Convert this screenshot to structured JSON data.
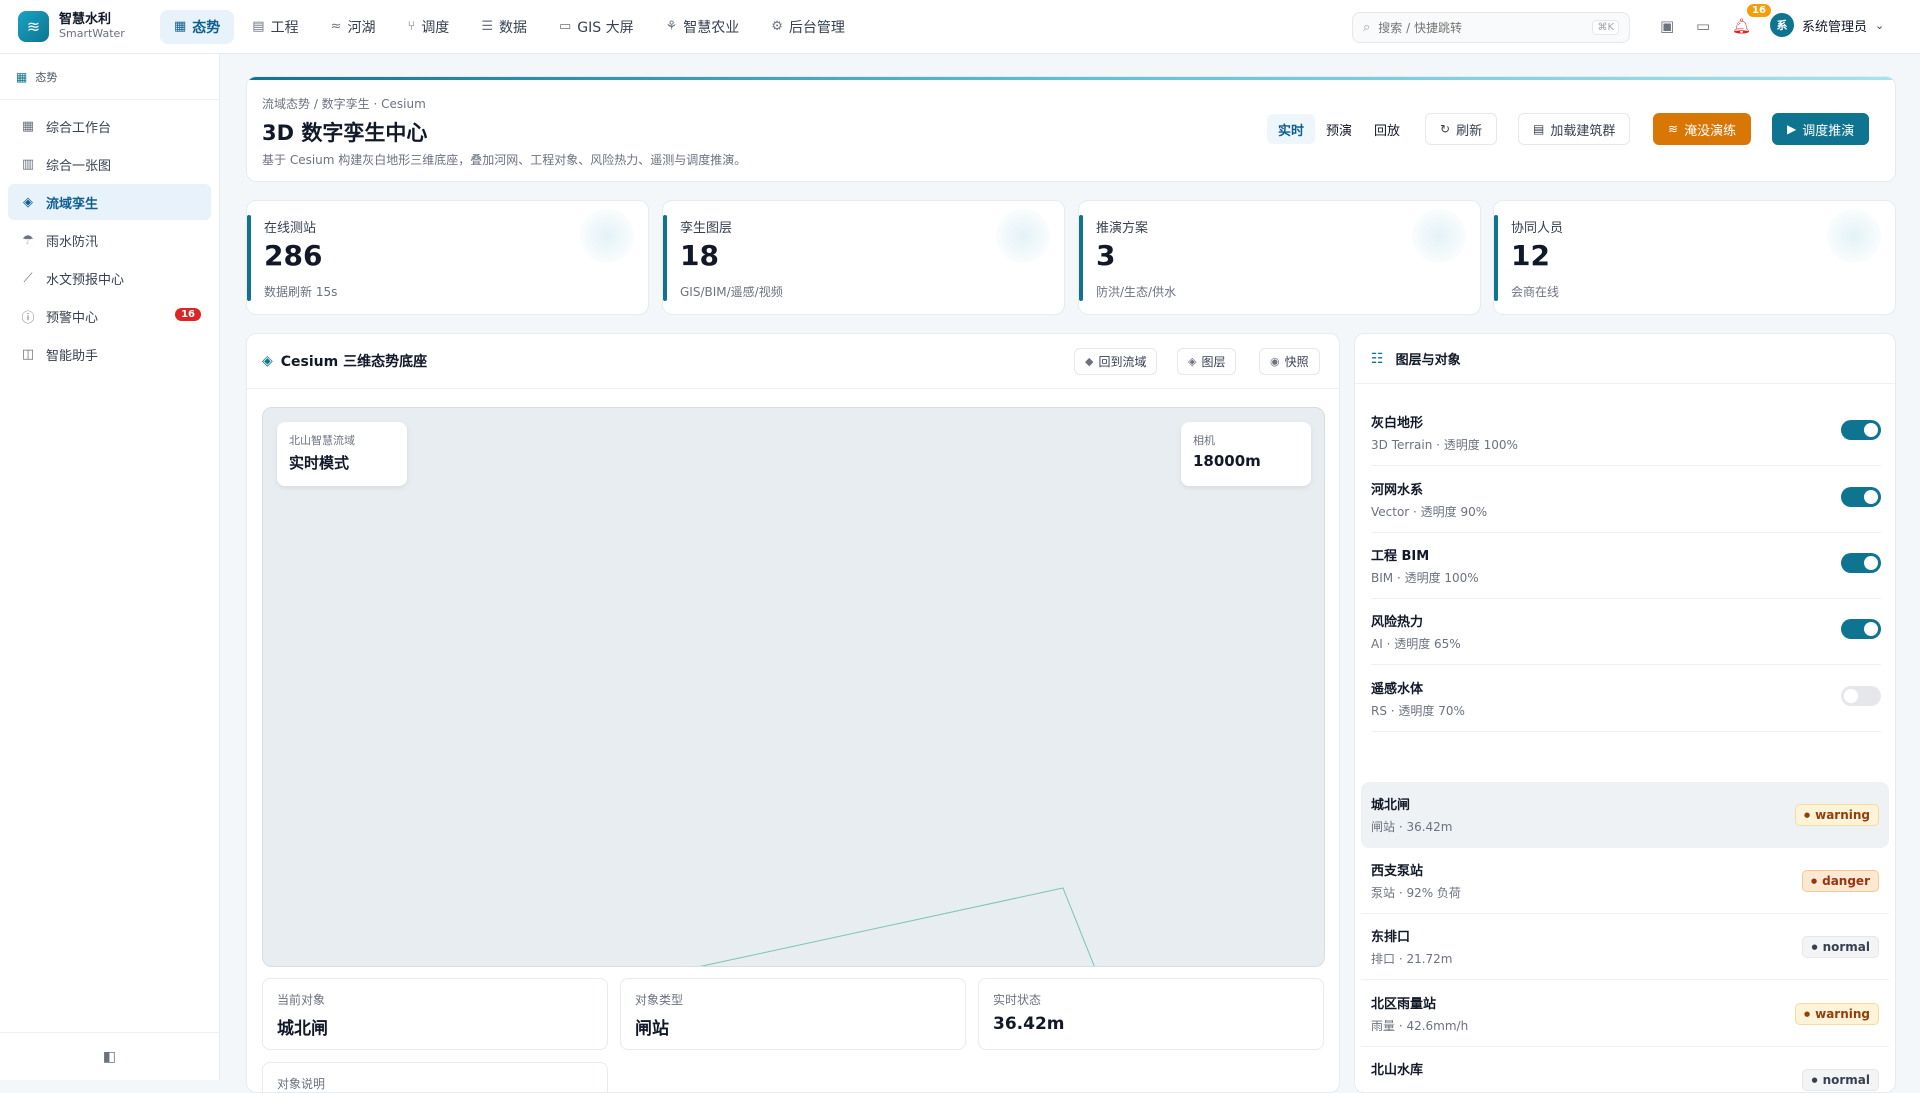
{
  "app": {
    "name": "智慧水利",
    "sub": "SmartWater",
    "logo_icon": "≋"
  },
  "nav": [
    {
      "label": "态势",
      "icon": "▦",
      "active": true
    },
    {
      "label": "工程",
      "icon": "▤",
      "active": false
    },
    {
      "label": "河湖",
      "icon": "≈",
      "active": false
    },
    {
      "label": "调度",
      "icon": "⑂",
      "active": false
    },
    {
      "label": "数据",
      "icon": "☰",
      "active": false
    },
    {
      "label": "GIS 大屏",
      "icon": "▭",
      "active": false
    },
    {
      "label": "智慧农业",
      "icon": "⚘",
      "active": false
    },
    {
      "label": "后台管理",
      "icon": "⚙",
      "active": false
    }
  ],
  "search": {
    "placeholder": "搜索 / 快捷跳转",
    "shortcut": "⌘K"
  },
  "topbar": {
    "notification_count": "16",
    "user_name": "系统管理员",
    "avatar_text": "系"
  },
  "sidebar": {
    "header": "态势",
    "items": [
      {
        "label": "综合工作台",
        "icon": "▦"
      },
      {
        "label": "综合一张图",
        "icon": "▥"
      },
      {
        "label": "流域孪生",
        "icon": "◈",
        "active": true
      },
      {
        "label": "雨水防汛",
        "icon": "☂"
      },
      {
        "label": "水文预报中心",
        "icon": "⟋"
      },
      {
        "label": "预警中心",
        "icon": "ⓘ",
        "badge": "16"
      },
      {
        "label": "智能助手",
        "icon": "◫"
      }
    ],
    "collapse_icon": "◧"
  },
  "header": {
    "breadcrumb": "流域态势 / 数字孪生 · Cesium",
    "title": "3D 数字孪生中心",
    "desc": "基于 Cesium 构建灰白地形三维底座，叠加河网、工程对象、风险热力、遥测与调度推演。",
    "modes": [
      "实时",
      "预演",
      "回放"
    ],
    "refresh": "刷新",
    "load_buildings": "加载建筑群",
    "flood_drill": "淹没演练",
    "dispatch": "调度推演"
  },
  "stats": [
    {
      "label": "在线测站",
      "value": "286",
      "sub": "数据刷新 15s"
    },
    {
      "label": "孪生图层",
      "value": "18",
      "sub": "GIS/BIM/遥感/视频"
    },
    {
      "label": "推演方案",
      "value": "3",
      "sub": "防洪/生态/供水"
    },
    {
      "label": "协同人员",
      "value": "12",
      "sub": "会商在线"
    }
  ],
  "cesium": {
    "title": "Cesium 三维态势底座",
    "back_to_basin": "回到流域",
    "layers_btn": "图层",
    "snapshot_btn": "快照",
    "basin_label": "北山智慧流域",
    "mode_value": "实时模式",
    "camera_label": "相机",
    "camera_value": "18000m",
    "current_object_label": "当前对象",
    "current_object": "城北闸",
    "object_type_label": "对象类型",
    "object_type": "闸站",
    "status_label": "实时状态",
    "status_value": "36.42m",
    "extra_label": "对象说明"
  },
  "layers_panel": {
    "title": "图层与对象",
    "layers": [
      {
        "name": "灰白地形",
        "meta": "3D Terrain · 透明度 100%",
        "on": true
      },
      {
        "name": "河网水系",
        "meta": "Vector · 透明度 90%",
        "on": true
      },
      {
        "name": "工程 BIM",
        "meta": "BIM · 透明度 100%",
        "on": true
      },
      {
        "name": "风险热力",
        "meta": "AI · 透明度 65%",
        "on": true
      },
      {
        "name": "遥感水体",
        "meta": "RS · 透明度 70%",
        "on": false
      }
    ],
    "objects": [
      {
        "name": "城北闸",
        "meta": "闸站 · 36.42m",
        "status": "warning",
        "selected": true
      },
      {
        "name": "西支泵站",
        "meta": "泵站 · 92% 负荷",
        "status": "danger"
      },
      {
        "name": "东排口",
        "meta": "排口 · 21.72m",
        "status": "normal"
      },
      {
        "name": "北区雨量站",
        "meta": "雨量 · 42.6mm/h",
        "status": "warning"
      },
      {
        "name": "北山水库",
        "meta": "",
        "status": "normal"
      }
    ]
  }
}
